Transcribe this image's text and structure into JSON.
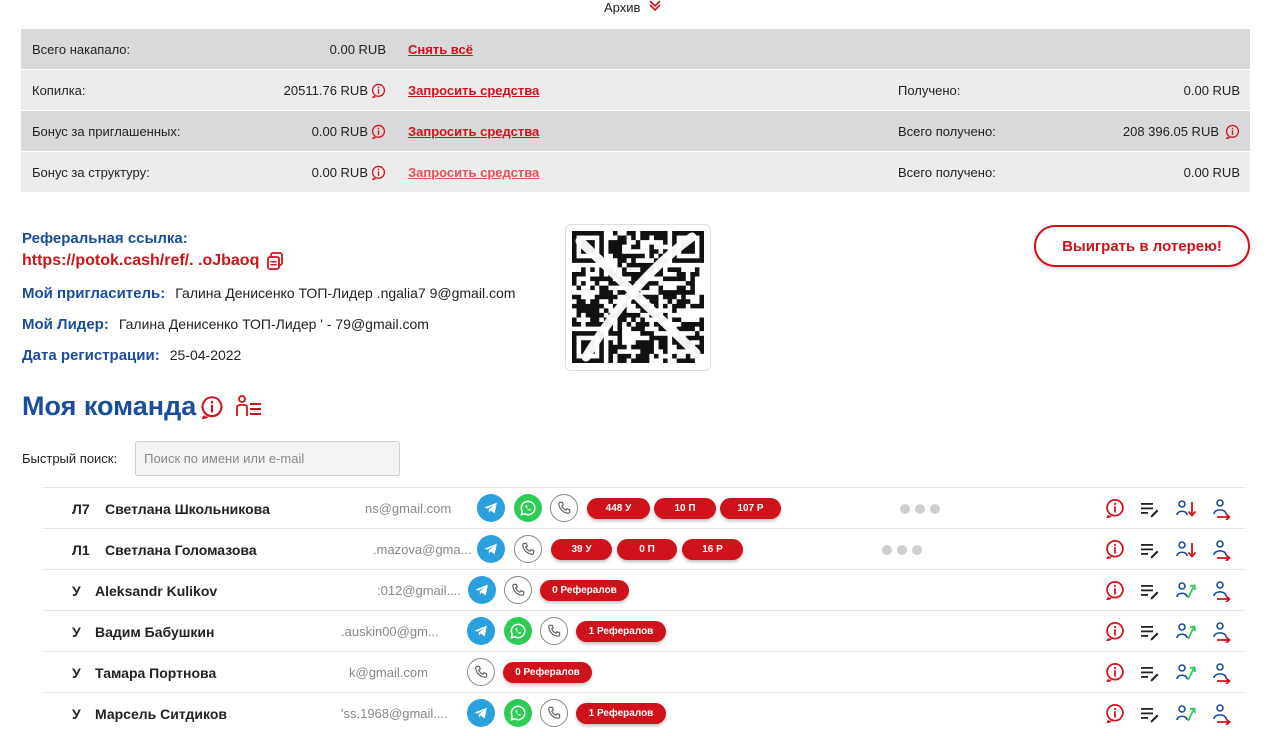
{
  "archive": {
    "label": "Архив"
  },
  "stats": {
    "rows": [
      {
        "label": "Всего накапало:",
        "value": "0.00 RUB",
        "action": "Снять всё",
        "right_label": "",
        "right_value": ""
      },
      {
        "label": "Копилка:",
        "value": "20511.76 RUB",
        "action": "Запросить средства",
        "right_label": "Получено:",
        "right_value": "0.00 RUB"
      },
      {
        "label": "Бонус за приглашенных:",
        "value": "0.00 RUB",
        "action": "Запросить средства",
        "right_label": "Всего получено:",
        "right_value": "208 396.05 RUB"
      },
      {
        "label": "Бонус за структуру:",
        "value": "0.00 RUB",
        "action": "Запросить средства",
        "right_label": "Всего получено:",
        "right_value": "0.00 RUB"
      }
    ]
  },
  "referral": {
    "title": "Реферальная ссылка:",
    "link": "https://potok.cash/ref/. .oJbaoq",
    "inviter_label": "Мой пригласитель:",
    "inviter_value": "Галина Денисенко ТОП-Лидер  .ngalia7 9@gmail.com",
    "leader_label": "Мой Лидер:",
    "leader_value": "Галина Денисенко ТОП-Лидер  '   -  79@gmail.com",
    "reg_label": "Дата регистрации:",
    "reg_value": "25-04-2022"
  },
  "lottery": {
    "label": "Выиграть в лотерею!"
  },
  "team": {
    "title": "Моя команда",
    "search_label": "Быстрый поиск:",
    "search_placeholder": "Поиск по имени или e-mail",
    "members": [
      {
        "level": "Л7",
        "name": "Светлана Школьникова",
        "email": "ns@gmail.com",
        "pills": [
          "448 У",
          "10 П",
          "107 Р"
        ]
      },
      {
        "level": "Л1",
        "name": "Светлана Голомазова",
        "email": ".mazova@gma...",
        "pills": [
          "39 У",
          "0 П",
          "16 Р"
        ]
      },
      {
        "level": "У",
        "name": "Aleksandr Kulikov",
        "email": ":012@gmail....",
        "pills": [
          "0 Рефералов"
        ]
      },
      {
        "level": "У",
        "name": "Вадим Бабушкин",
        "email": ".auskin00@gm...",
        "pills": [
          "1 Рефералов"
        ]
      },
      {
        "level": "У",
        "name": "Тамара Портнова",
        "email": "k@gmail.com",
        "pills": [
          "0 Рефералов"
        ]
      },
      {
        "level": "У",
        "name": "Марсель Ситдиков",
        "email": "'ss.1968@gmail....",
        "pills": [
          "1 Рефералов"
        ]
      }
    ]
  },
  "colors": {
    "accent_red": "#d0121b",
    "brand_blue": "#1a4d9c",
    "telegram": "#2aa0dd",
    "whatsapp": "#2ecc55"
  }
}
